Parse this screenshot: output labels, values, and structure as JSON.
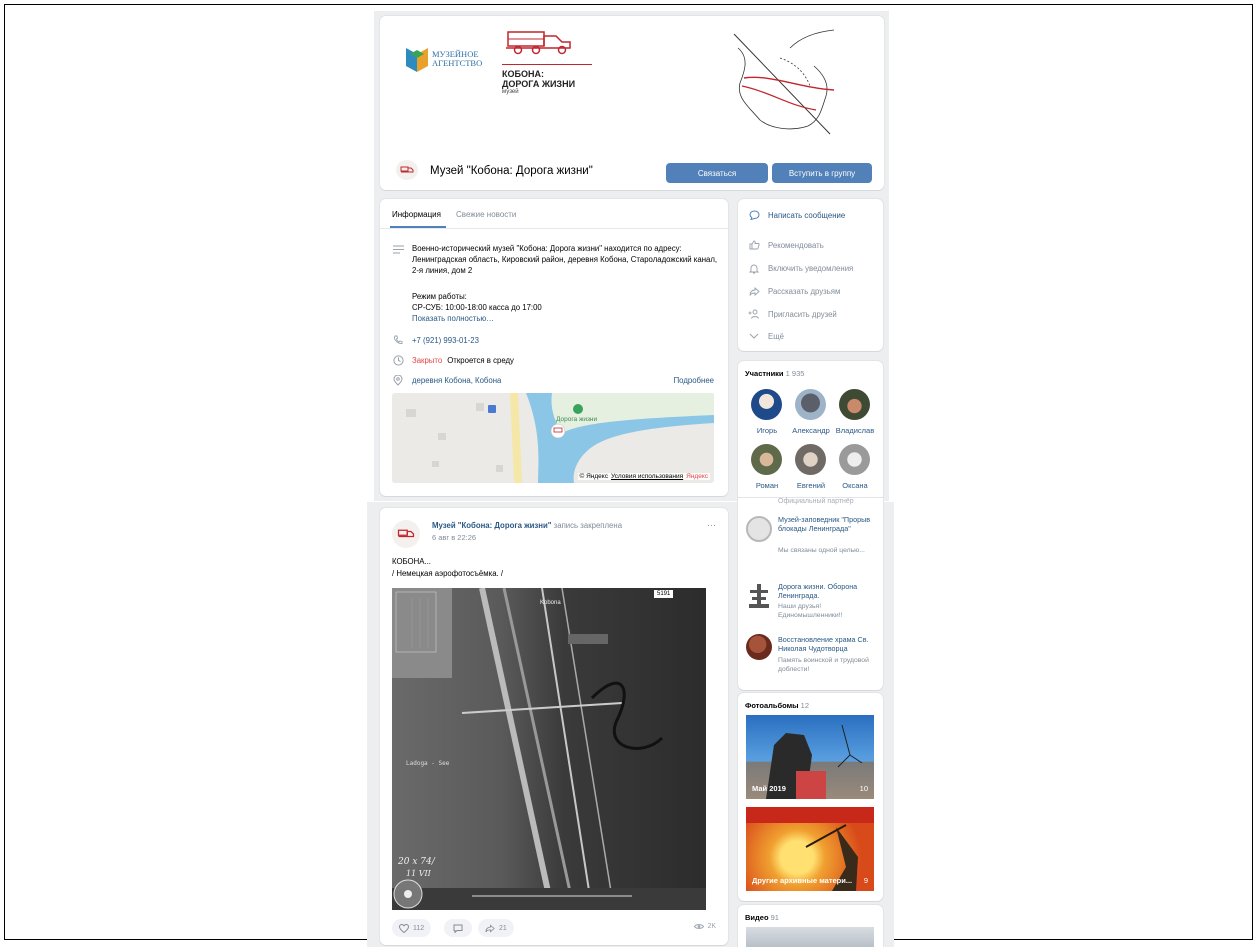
{
  "header": {
    "agency_logo_line1": "МУЗЕЙНОЕ",
    "agency_logo_line2": "АГЕНТСТВО",
    "museum_logo_line1": "КОБОНА:",
    "museum_logo_line2": "ДОРОГА ЖИЗНИ",
    "museum_logo_line3": "музей",
    "group_name": "Музей \"Кобона: Дорога жизни\"",
    "contact_button": "Связаться",
    "join_button": "Вступить в группу"
  },
  "info": {
    "tabs": [
      "Информация",
      "Свежие новости"
    ],
    "description": "Военно-исторический музей \"Кобона: Дорога жизни\" находится по адресу: Ленинградская область, Кировский район, деревня Кобона, Староладожский канал, 2-я линия, дом 2",
    "hours_title": "Режим работы:",
    "hours": "СР-СУБ: 10:00-18:00 касса до 17:00",
    "show_full": "Показать полностью…",
    "phone": "+7 (921) 993-01-23",
    "status_closed": "Закрыто",
    "status_opens": "Откроется в среду",
    "address": "деревня Кобона, Кобона",
    "more": "Подробнее",
    "map_label": "Дорога жизни",
    "map_copyright": "© Яндекс",
    "map_terms": "Условия использования",
    "map_brand": "Яндекс"
  },
  "actions": [
    {
      "icon": "message-icon",
      "label": "Написать сообщение"
    },
    {
      "icon": "thumb-up-icon",
      "label": "Рекомендовать"
    },
    {
      "icon": "bell-icon",
      "label": "Включить уведомления"
    },
    {
      "icon": "share-icon",
      "label": "Рассказать друзьям"
    },
    {
      "icon": "add-user-icon",
      "label": "Пригласить друзей"
    },
    {
      "icon": "chevron-down-icon",
      "label": "Ещё"
    }
  ],
  "members": {
    "title": "Участники",
    "count": "1 935",
    "people": [
      "Игорь",
      "Александр",
      "Владислав",
      "Роман",
      "Евгений",
      "Оксана"
    ]
  },
  "post": {
    "author": "Музей \"Кобона: Дорога жизни\"",
    "pinned": "запись закреплена",
    "date": "6 авг в 22:26",
    "menu": "···",
    "text_line1": "КОБОНА...",
    "text_line2": "/ Немецкая аэрофотосъёмка. /",
    "photo_label_top": "Kobona",
    "photo_label_lake": "Ladoga - See",
    "photo_corner": "5191",
    "likes": "112",
    "reposts": "21",
    "views": "2K"
  },
  "links": {
    "cut_text": "Официальный партнёр",
    "items": [
      {
        "title": "Музей-заповедник \"Прорыв блокады Ленинграда\"",
        "desc": "Мы связаны одной целью..."
      },
      {
        "title": "Дорога жизни. Оборона Ленинграда.",
        "desc": "Наши друзья! Единомышленники!!"
      },
      {
        "title": "Восстановление храма Св. Николая Чудотворца",
        "desc": "Память воинской и трудовой доблести!"
      }
    ]
  },
  "albums": {
    "title": "Фотоальбомы",
    "count": "12",
    "items": [
      {
        "name": "Май 2019",
        "count": "10"
      },
      {
        "name": "Другие архивные матери...",
        "count": "9"
      }
    ]
  },
  "video": {
    "title": "Видео",
    "count": "91"
  },
  "colors": {
    "accent": "#5181b8",
    "link": "#2a5885",
    "closed": "#e64646",
    "page_bg": "#edeef0",
    "brand_red": "#c0262d"
  }
}
